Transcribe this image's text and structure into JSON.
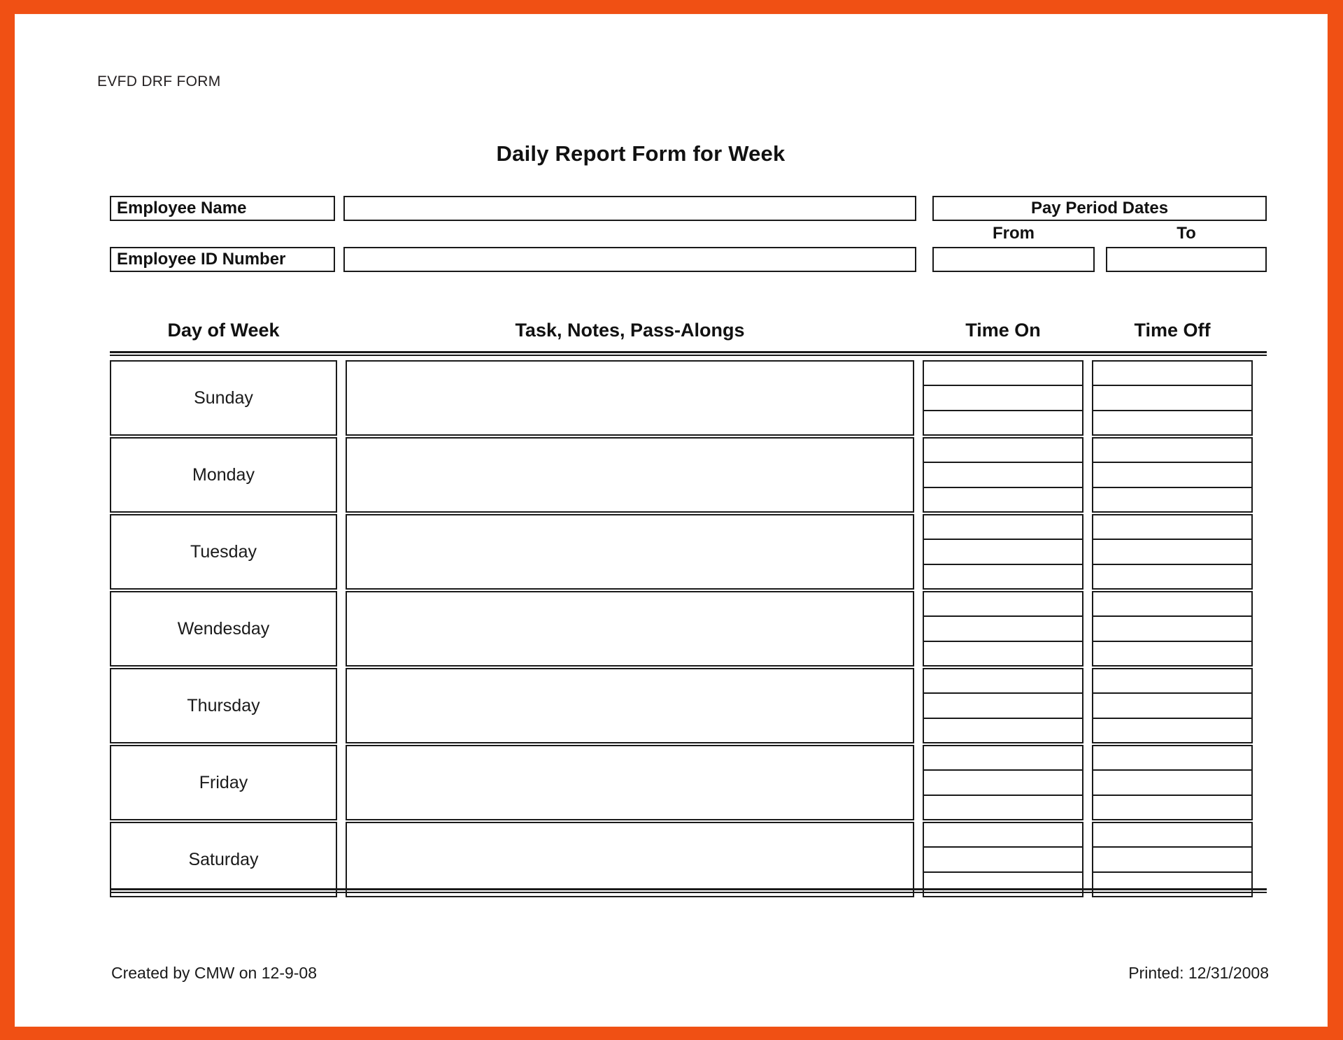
{
  "frame": {
    "border_color": "#f05014",
    "page_color": "#ffffff"
  },
  "document": {
    "form_id": "EVFD DRF FORM",
    "title": "Daily Report Form for Week"
  },
  "identification": {
    "employee_name_label": "Employee Name",
    "employee_name_value": "",
    "employee_id_label": "Employee ID Number",
    "employee_id_value": "",
    "pay_period_label": "Pay Period Dates",
    "from_label": "From",
    "from_value": "",
    "to_label": "To",
    "to_value": ""
  },
  "table": {
    "columns": [
      "Day of Week",
      "Task, Notes, Pass-Alongs",
      "Time On",
      "Time Off"
    ],
    "time_slots_per_cell": 3,
    "rows": [
      {
        "day": "Sunday",
        "task": "",
        "time_on": [
          "",
          "",
          ""
        ],
        "time_off": [
          "",
          "",
          ""
        ]
      },
      {
        "day": "Monday",
        "task": "",
        "time_on": [
          "",
          "",
          ""
        ],
        "time_off": [
          "",
          "",
          ""
        ]
      },
      {
        "day": "Tuesday",
        "task": "",
        "time_on": [
          "",
          "",
          ""
        ],
        "time_off": [
          "",
          "",
          ""
        ]
      },
      {
        "day": "Wendesday",
        "task": "",
        "time_on": [
          "",
          "",
          ""
        ],
        "time_off": [
          "",
          "",
          ""
        ]
      },
      {
        "day": "Thursday",
        "task": "",
        "time_on": [
          "",
          "",
          ""
        ],
        "time_off": [
          "",
          "",
          ""
        ]
      },
      {
        "day": "Friday",
        "task": "",
        "time_on": [
          "",
          "",
          ""
        ],
        "time_off": [
          "",
          "",
          ""
        ]
      },
      {
        "day": "Saturday",
        "task": "",
        "time_on": [
          "",
          "",
          ""
        ],
        "time_off": [
          "",
          "",
          ""
        ]
      }
    ]
  },
  "footer": {
    "created": "Created by CMW on 12-9-08",
    "printed": "Printed: 12/31/2008"
  }
}
